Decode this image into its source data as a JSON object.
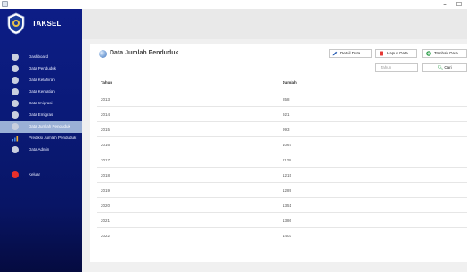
{
  "app": {
    "name": "TAKSEL"
  },
  "window_controls": {
    "minimize": "–",
    "maximize": "☐"
  },
  "sidebar": {
    "items": [
      {
        "label": "Dashboard",
        "icon": "dashboard-icon",
        "active": false
      },
      {
        "label": "Data Penduduk",
        "icon": "citizen-data-icon",
        "active": false
      },
      {
        "label": "Data Kelahiran",
        "icon": "birth-data-icon",
        "active": false
      },
      {
        "label": "Data Kematian",
        "icon": "death-data-icon",
        "active": false
      },
      {
        "label": "Data Imigrasi",
        "icon": "immigration-data-icon",
        "active": false
      },
      {
        "label": "Data Emigrasi",
        "icon": "emigration-data-icon",
        "active": false
      },
      {
        "label": "Data Jumlah Penduduk",
        "icon": "population-count-icon",
        "active": true
      },
      {
        "label": "Prediksi Jumlah Penduduk",
        "icon": "prediction-chart-icon",
        "active": false
      },
      {
        "label": "Data Admin",
        "icon": "admin-user-icon",
        "active": false
      },
      {
        "label": "Keluar",
        "icon": "logout-icon",
        "active": false
      }
    ]
  },
  "main": {
    "title": "Data Jumlah Penduduk",
    "actions": {
      "detail": "Detail Data",
      "hapus": "Hapus Data",
      "tambah": "Tambah Data"
    },
    "search": {
      "placeholder": "Tahun",
      "button": "Cari"
    },
    "table": {
      "columns": [
        "Tahun",
        "Jumlah"
      ],
      "rows": [
        [
          "2013",
          "858"
        ],
        [
          "2014",
          "921"
        ],
        [
          "2015",
          "993"
        ],
        [
          "2016",
          "1067"
        ],
        [
          "2017",
          "1128"
        ],
        [
          "2018",
          "1215"
        ],
        [
          "2019",
          "1289"
        ],
        [
          "2020",
          "1351"
        ],
        [
          "2021",
          "1386"
        ],
        [
          "2022",
          "1403"
        ]
      ]
    }
  },
  "colors": {
    "sidebar": "#0d1d86",
    "sidebar_active": "#9ab0d6",
    "delete_red": "#e53935",
    "add_green": "#2e9e4a",
    "edit_blue": "#2b5fb4",
    "logout_red": "#e8302a",
    "predict_blue": "#3b82e0"
  }
}
